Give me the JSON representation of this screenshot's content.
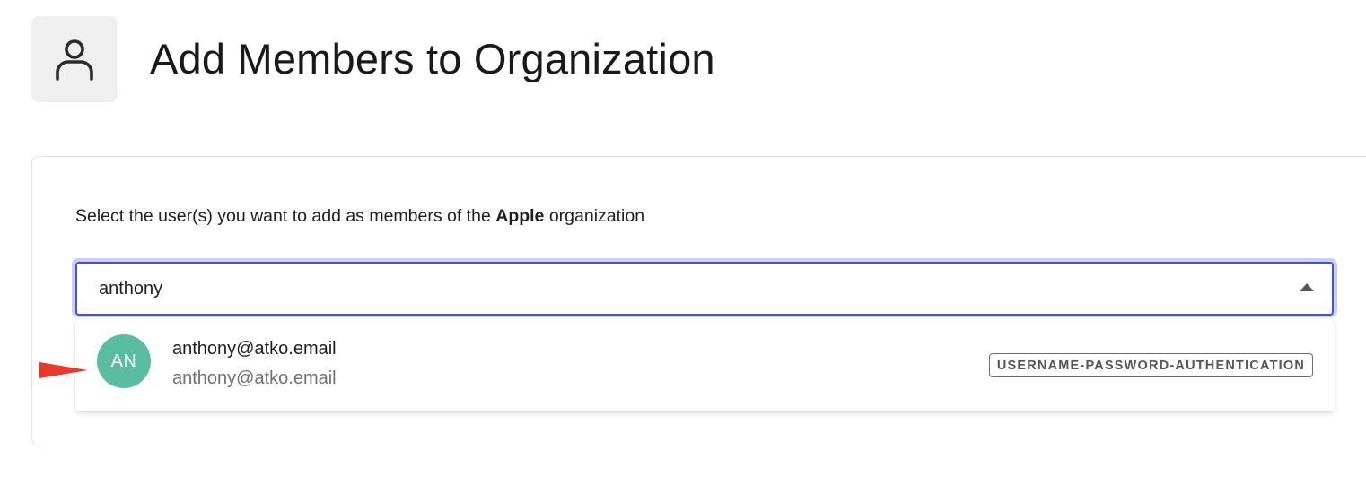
{
  "header": {
    "icon": "user-icon",
    "title": "Add Members to Organization"
  },
  "card": {
    "instruction_prefix": "Select the user(s) you want to add as members of the ",
    "organization_name": "Apple",
    "instruction_suffix": " organization"
  },
  "search": {
    "value": "anthony",
    "focus_color": "#4254cf"
  },
  "results": [
    {
      "initials": "AN",
      "name": "anthony@atko.email",
      "email": "anthony@atko.email",
      "connection": "USERNAME-PASSWORD-AUTHENTICATION",
      "avatar_color": "#5bbd9f"
    }
  ],
  "annotation": {
    "arrow_color": "#e8392b"
  }
}
